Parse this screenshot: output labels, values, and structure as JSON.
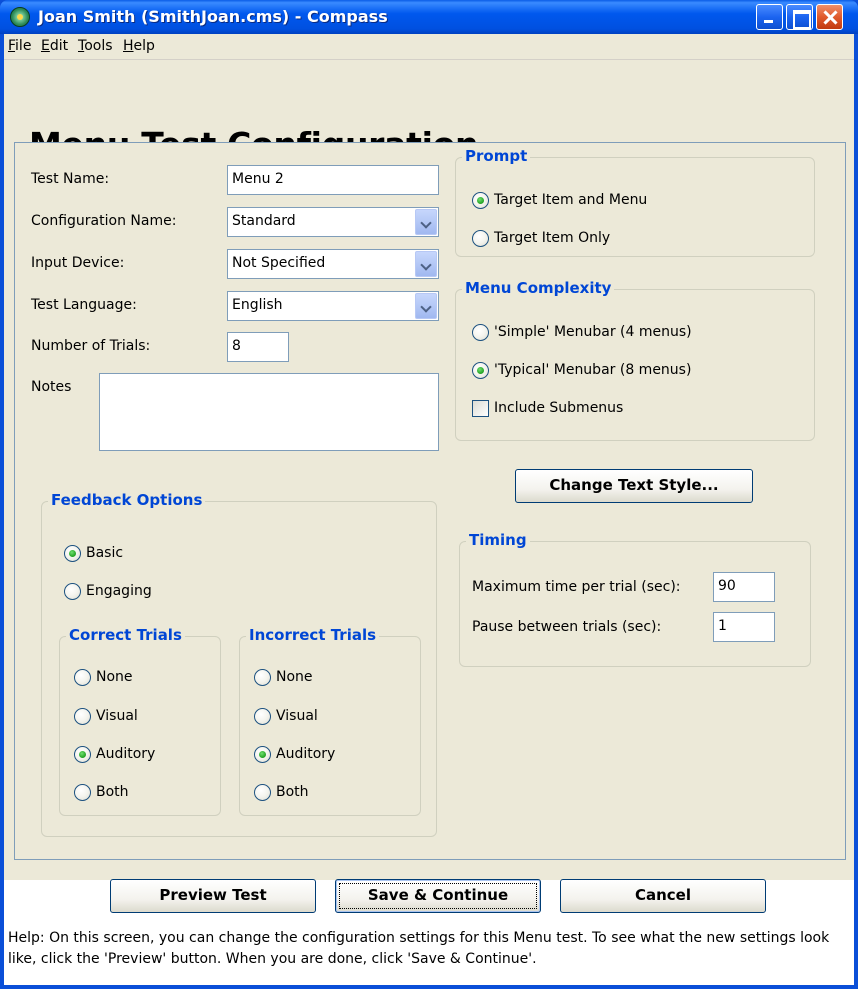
{
  "window": {
    "title": "Joan Smith (SmithJoan.cms) - Compass"
  },
  "menubar": {
    "file": {
      "mnemonic": "F",
      "rest": "ile"
    },
    "edit": {
      "mnemonic": "E",
      "rest": "dit"
    },
    "tools": {
      "mnemonic": "T",
      "rest": "ools"
    },
    "help": {
      "mnemonic": "H",
      "rest": "elp"
    }
  },
  "page": {
    "heading": "Menu Test Configuration"
  },
  "form": {
    "test_name_label": "Test Name:",
    "test_name_value": "Menu 2",
    "config_name_label": "Configuration Name:",
    "config_name_value": "Standard",
    "input_device_label": "Input Device:",
    "input_device_value": "Not Specified",
    "language_label": "Test Language:",
    "language_value": "English",
    "trials_label": "Number of Trials:",
    "trials_value": "8",
    "notes_label": "Notes",
    "notes_value": ""
  },
  "feedback": {
    "title": "Feedback Options",
    "basic": "Basic",
    "engaging": "Engaging",
    "selected": "Basic",
    "correct": {
      "title": "Correct Trials",
      "options": [
        "None",
        "Visual",
        "Auditory",
        "Both"
      ],
      "selected": "Auditory"
    },
    "incorrect": {
      "title": "Incorrect Trials",
      "options": [
        "None",
        "Visual",
        "Auditory",
        "Both"
      ],
      "selected": "Auditory"
    }
  },
  "prompt": {
    "title": "Prompt",
    "options": [
      "Target Item and Menu",
      "Target Item Only"
    ],
    "selected": "Target Item and Menu"
  },
  "complexity": {
    "title": "Menu Complexity",
    "options": [
      "'Simple' Menubar (4 menus)",
      "'Typical' Menubar (8 menus)"
    ],
    "selected": "'Typical' Menubar (8 menus)",
    "submenus_label": "Include Submenus",
    "submenus_checked": false
  },
  "text_style_button": "Change Text Style...",
  "timing": {
    "title": "Timing",
    "max_label": "Maximum time per trial (sec):",
    "max_value": "90",
    "pause_label": "Pause between trials (sec):",
    "pause_value": "1"
  },
  "buttons": {
    "preview": "Preview Test",
    "save": "Save & Continue",
    "cancel": "Cancel"
  },
  "help": {
    "text": "Help:  On this screen, you can change the configuration settings for this Menu test.  To see what the new settings look like, click the 'Preview' button.  When you are done, click 'Save & Continue'."
  },
  "colors": {
    "group_title": "#0046d5",
    "dialog_bg": "#ece9d8",
    "titlebar": "#0058ee"
  }
}
